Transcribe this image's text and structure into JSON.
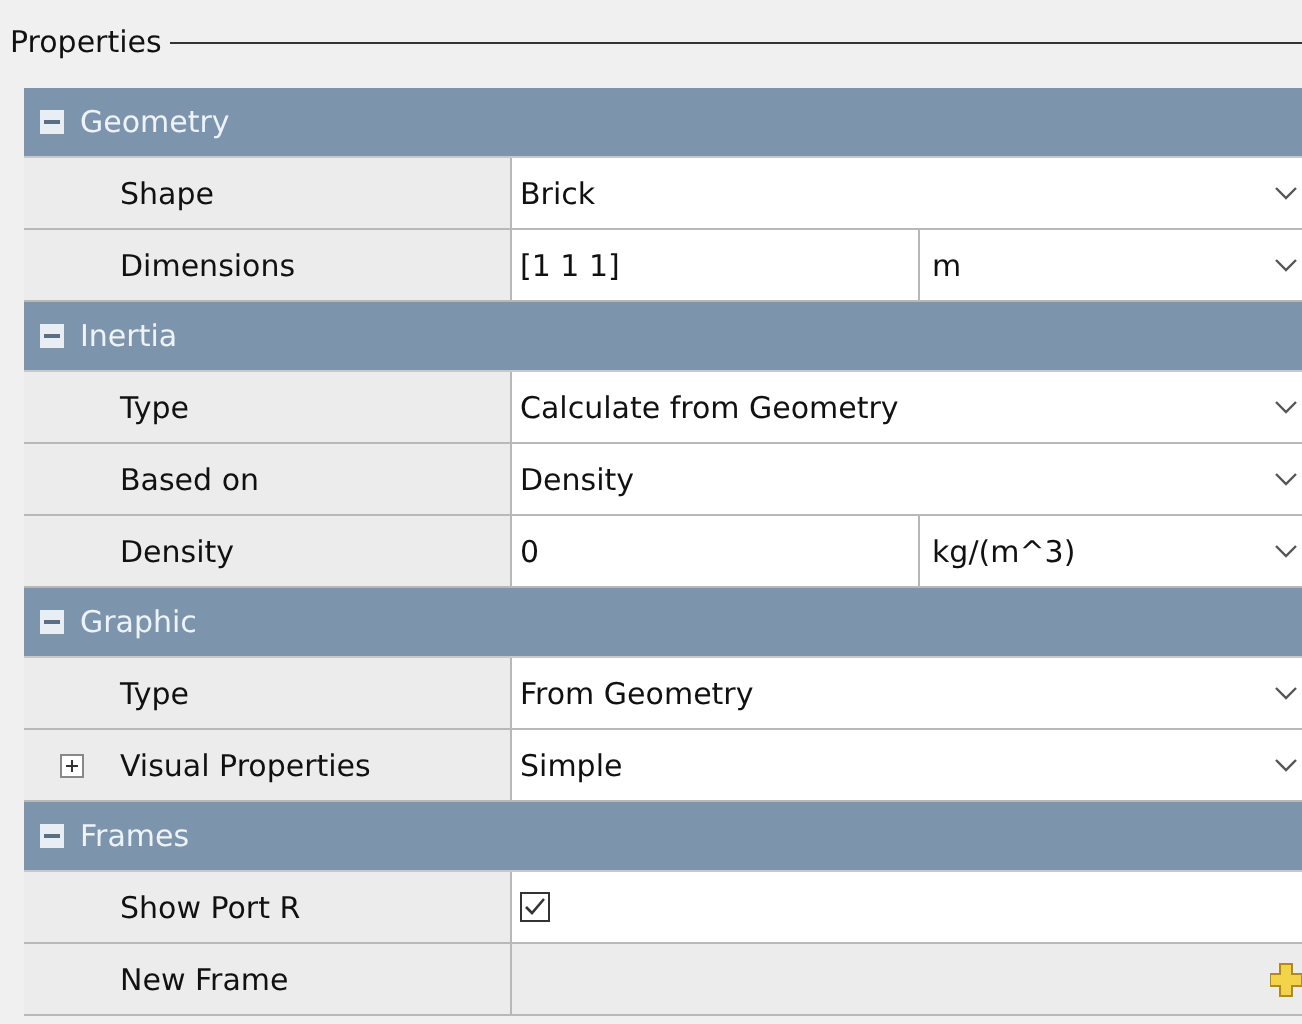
{
  "panel": {
    "title": "Properties"
  },
  "sections": [
    {
      "title": "Geometry",
      "expanded": true,
      "rows": [
        {
          "kind": "dropdown",
          "label": "Shape",
          "value": "Brick"
        },
        {
          "kind": "dropdown_unit",
          "label": "Dimensions",
          "value": "[1 1 1]",
          "unit": "m"
        }
      ]
    },
    {
      "title": "Inertia",
      "expanded": true,
      "rows": [
        {
          "kind": "dropdown",
          "label": "Type",
          "value": "Calculate from Geometry"
        },
        {
          "kind": "dropdown",
          "label": "Based on",
          "value": "Density"
        },
        {
          "kind": "dropdown_unit",
          "label": "Density",
          "value": "0",
          "unit": "kg/(m^3)"
        }
      ]
    },
    {
      "title": "Graphic",
      "expanded": true,
      "rows": [
        {
          "kind": "dropdown",
          "label": "Type",
          "value": "From Geometry"
        },
        {
          "kind": "dropdown",
          "label": "Visual Properties",
          "value": "Simple",
          "expanded": false
        }
      ]
    },
    {
      "title": "Frames",
      "expanded": true,
      "rows": [
        {
          "kind": "checkbox",
          "label": "Show Port R",
          "checked": true
        },
        {
          "kind": "button",
          "label": "New Frame"
        }
      ]
    }
  ]
}
